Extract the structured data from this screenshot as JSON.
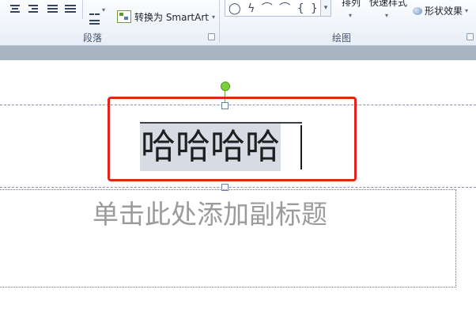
{
  "ribbon": {
    "convert_smartart": "转换为 SmartArt",
    "paragraph_group": "段落",
    "drawing_group": "绘图",
    "arrange": "排列",
    "quick_styles": "快速样式",
    "shape_effects": "形状效果",
    "shape_glyphs": "◯ ϟ ⌒ ⌒ { }"
  },
  "slide": {
    "title_text": "哈哈哈哈",
    "subtitle_placeholder": "单击此处添加副标题"
  },
  "colors": {
    "highlight_frame": "#e3231d",
    "rotation_handle": "#7ed03a",
    "selection_bg": "#d6dbe4"
  }
}
